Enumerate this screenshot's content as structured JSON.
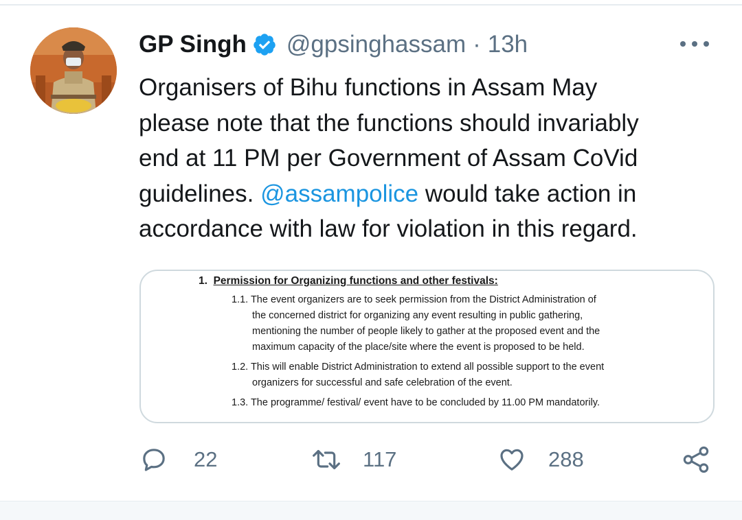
{
  "tweet": {
    "author_name": "GP Singh",
    "handle": "@gpsinghassam",
    "separator": "·",
    "time": "13h",
    "text_lines": [
      "Organisers of Bihu functions in Assam May",
      "please note that the functions should invariably",
      "end at 11 PM per Government of Assam CoVid"
    ],
    "line4_before": "guidelines. ",
    "mention": "@assampolice",
    "line4_after": " would take action in",
    "line5": "accordance with law for violation in this regard."
  },
  "media": {
    "heading_number": "1.",
    "heading": "Permission for Organizing functions and other festivals:",
    "lines": [
      "1.1. The event organizers are to seek permission from the District Administration of",
      "the concerned district for organizing any event resulting in public gathering,",
      "mentioning the number of people likely to gather at the proposed event and the",
      "maximum capacity of the place/site where the event is proposed to be held.",
      "1.2. This will enable District Administration to extend all possible support to the event",
      "organizers for successful and safe celebration of the event.",
      "1.3. The programme/ festival/ event have to be concluded by 11.00 PM mandatorily."
    ]
  },
  "actions": {
    "replies": "22",
    "retweets": "117",
    "likes": "288"
  },
  "colors": {
    "text": "#14171a",
    "secondary": "#5b7083",
    "link": "#1b95e0",
    "verified": "#1da1f2"
  },
  "icons": [
    "verified-badge-icon",
    "more-icon",
    "reply-icon",
    "retweet-icon",
    "like-icon",
    "share-icon"
  ]
}
